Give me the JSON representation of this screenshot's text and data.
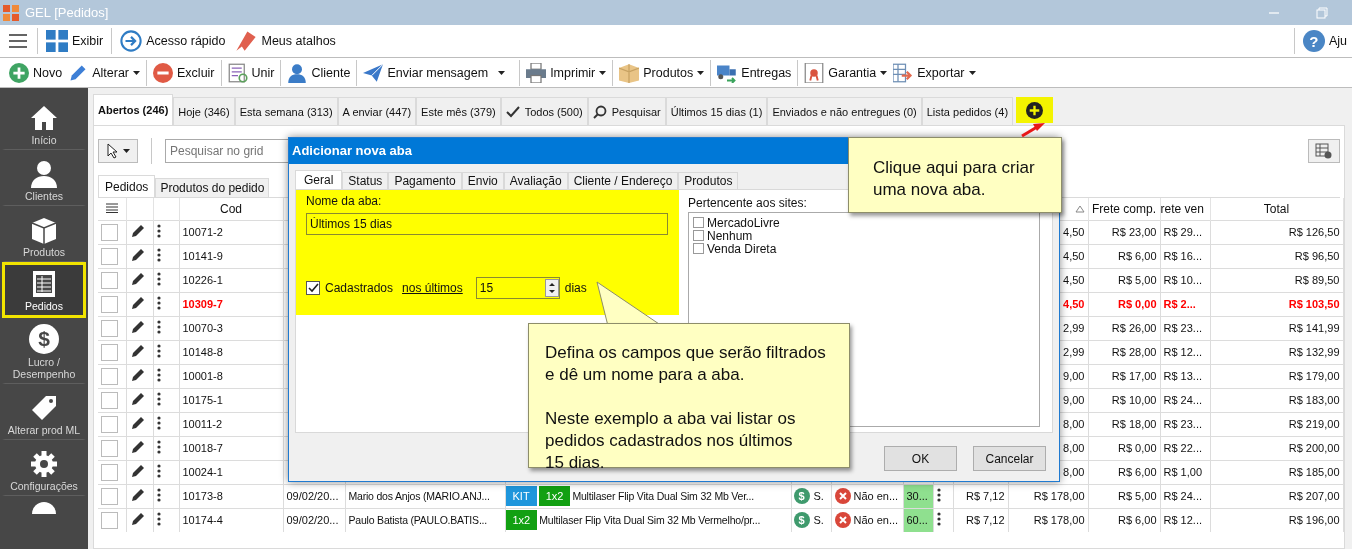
{
  "window": {
    "title": "GEL [Pedidos]"
  },
  "menu_bar": [
    {
      "label": "Exibir"
    },
    {
      "label": "Acesso rápido"
    },
    {
      "label": "Meus atalhos"
    }
  ],
  "help": {
    "glyph": "?",
    "label": "Aju"
  },
  "toolbar": [
    {
      "label": "Novo",
      "dropdown": false
    },
    {
      "label": "Alterar",
      "dropdown": true
    },
    {
      "label": "Excluir",
      "dropdown": false
    },
    {
      "label": "Unir",
      "dropdown": false
    },
    {
      "label": "Cliente",
      "dropdown": false
    },
    {
      "label": "Enviar mensagem",
      "dropdown": true
    },
    {
      "label": "Imprimir",
      "dropdown": true
    },
    {
      "label": "Produtos",
      "dropdown": true
    },
    {
      "label": "Entregas",
      "dropdown": false
    },
    {
      "label": "Garantia",
      "dropdown": true
    },
    {
      "label": "Exportar",
      "dropdown": true
    }
  ],
  "sidebar": {
    "items": [
      {
        "label": "Início",
        "selected": false
      },
      {
        "label": "Clientes",
        "selected": false
      },
      {
        "label": "Produtos",
        "selected": false
      },
      {
        "label": "Pedidos",
        "selected": true
      },
      {
        "label": "Lucro / Desempenho",
        "selected": false,
        "glyph": "$"
      },
      {
        "label": "Alterar prod ML",
        "selected": false
      },
      {
        "label": "Configurações",
        "selected": false
      }
    ]
  },
  "tabs": [
    {
      "label": "Abertos (246)",
      "selected": true,
      "kind": "plain"
    },
    {
      "label": "Hoje (346)",
      "selected": false,
      "kind": "plain"
    },
    {
      "label": "Esta semana (313)",
      "selected": false,
      "kind": "plain"
    },
    {
      "label": "A enviar (447)",
      "selected": false,
      "kind": "plain"
    },
    {
      "label": "Este mês (379)",
      "selected": false,
      "kind": "plain"
    },
    {
      "label": "Todos (500)",
      "selected": false,
      "kind": "check"
    },
    {
      "label": "Pesquisar",
      "selected": false,
      "kind": "search"
    },
    {
      "label": "Últimos 15 dias (1)",
      "selected": false,
      "kind": "plain"
    },
    {
      "label": "Enviados e não entregues (0)",
      "selected": false,
      "kind": "plain"
    },
    {
      "label": "Lista pedidos (4)",
      "selected": false,
      "kind": "plain"
    }
  ],
  "search": {
    "placeholder": "Pesquisar no grid"
  },
  "subtabs": [
    {
      "label": "Pedidos",
      "selected": true
    },
    {
      "label": "Produtos do pedido",
      "selected": false
    }
  ],
  "table": {
    "columns": {
      "cod": "Cod",
      "frete_comp": "Frete comp.",
      "frete_vend": "rete ven",
      "total": "Total"
    },
    "rows": [
      {
        "checked": false,
        "flagged": false,
        "cod": "10071-2",
        "column_13": "4,50",
        "frete_comp": "R$ 23,00",
        "frete_vend": "R$ 29...",
        "total": "R$ 126,50"
      },
      {
        "checked": false,
        "flagged": false,
        "cod": "10141-9",
        "column_13": "4,50",
        "frete_comp": "R$ 6,00",
        "frete_vend": "R$ 16...",
        "total": "R$ 96,50"
      },
      {
        "checked": false,
        "flagged": false,
        "cod": "10226-1",
        "column_13": "4,50",
        "frete_comp": "R$ 5,00",
        "frete_vend": "R$ 10...",
        "total": "R$ 89,50"
      },
      {
        "checked": false,
        "flagged": true,
        "cod": "10309-7",
        "column_13": "4,50",
        "frete_comp": "R$ 0,00",
        "frete_vend": "R$ 2...",
        "total": "R$ 103,50"
      },
      {
        "checked": false,
        "flagged": false,
        "cod": "10070-3",
        "column_13": "2,99",
        "frete_comp": "R$ 26,00",
        "frete_vend": "R$ 23...",
        "total": "R$ 141,99"
      },
      {
        "checked": false,
        "flagged": false,
        "cod": "10148-8",
        "column_13": "2,99",
        "frete_comp": "R$ 28,00",
        "frete_vend": "R$ 12...",
        "total": "R$ 132,99"
      },
      {
        "checked": false,
        "flagged": false,
        "cod": "10001-8",
        "column_13": "9,00",
        "frete_comp": "R$ 17,00",
        "frete_vend": "R$ 13...",
        "total": "R$ 179,00"
      },
      {
        "checked": false,
        "flagged": false,
        "cod": "10175-1",
        "column_13": "9,00",
        "frete_comp": "R$ 10,00",
        "frete_vend": "R$ 24...",
        "total": "R$ 183,00"
      },
      {
        "checked": false,
        "flagged": false,
        "cod": "10011-2",
        "column_13": "8,00",
        "frete_comp": "R$ 18,00",
        "frete_vend": "R$ 23...",
        "total": "R$ 219,00"
      },
      {
        "checked": false,
        "flagged": false,
        "cod": "10018-7",
        "column_13": "8,00",
        "frete_comp": "R$ 0,00",
        "frete_vend": "R$ 22...",
        "total": "R$ 200,00"
      },
      {
        "checked": false,
        "flagged": false,
        "cod": "10024-1",
        "column_13": "8,00",
        "frete_comp": "R$ 6,00",
        "frete_vend": "R$ 1,00",
        "total": "R$ 185,00"
      },
      {
        "checked": false,
        "flagged": false,
        "cod": "10173-8",
        "column_5": "09/02/20...",
        "column_6": "Mario dos Anjos (MARIO.ANJ...",
        "column_7": [
          {
            "label": "KIT",
            "color": "#1e96dc"
          },
          {
            "label": "1x2",
            "color": "#12a012"
          }
        ],
        "column_8": "Multilaser Flip Vita Dual Sim 32 Mb Ver...",
        "column_9": {
          "glyph": "$",
          "text": "S."
        },
        "column_10": "Não en...",
        "column_11": "30...",
        "column_12": "R$ 7,12",
        "column_13": "R$ 178,00",
        "frete_comp": "R$ 5,00",
        "frete_vend": "R$ 24...",
        "total": "R$ 207,00"
      },
      {
        "checked": false,
        "flagged": false,
        "cod": "10174-4",
        "column_5": "09/02/20...",
        "column_6": "Paulo Batista (PAULO.BATIS...",
        "column_7": [
          {
            "label": "1x2",
            "color": "#12a012"
          }
        ],
        "column_8": "Multilaser Flip Vita Dual Sim 32 Mb Vermelho/pr...",
        "column_9": {
          "glyph": "$",
          "text": "S."
        },
        "column_10": "Não en...",
        "column_11": "60...",
        "column_12": "R$ 7,12",
        "column_13": "R$ 178,00",
        "frete_comp": "R$ 6,00",
        "frete_vend": "R$ 12...",
        "total": "R$ 196,00"
      }
    ]
  },
  "dialog": {
    "title": "Adicionar nova aba",
    "tabs": [
      {
        "label": "Geral",
        "selected": true
      },
      {
        "label": "Status",
        "selected": false
      },
      {
        "label": "Pagamento",
        "selected": false
      },
      {
        "label": "Envio",
        "selected": false
      },
      {
        "label": "Avaliação",
        "selected": false
      },
      {
        "label": "Cliente / Endereço",
        "selected": false
      },
      {
        "label": "Produtos",
        "selected": false
      }
    ],
    "name_label": "Nome da aba:",
    "name_value": "Últimos 15 dias",
    "filter": {
      "checked": true,
      "label": "Cadastrados",
      "link": "nos últimos",
      "value": "15",
      "unit": "dias"
    },
    "sites_label": "Pertencente aos sites:",
    "sites": [
      {
        "label": "MercadoLivre",
        "checked": false
      },
      {
        "label": "Nenhum",
        "checked": false
      },
      {
        "label": "Venda Direta",
        "checked": false
      }
    ],
    "buttons": [
      "OK",
      "Cancelar"
    ]
  },
  "callouts": [
    {
      "paragraphs": [
        "Clique aqui para criar\numa nova aba."
      ]
    },
    {
      "paragraphs": [
        "Defina os campos que serão filtrados\ne dê um nome para a aba.",
        "Neste exemplo a aba vai listar os\npedidos cadastrados nos últimos\n15 dias."
      ]
    }
  ]
}
